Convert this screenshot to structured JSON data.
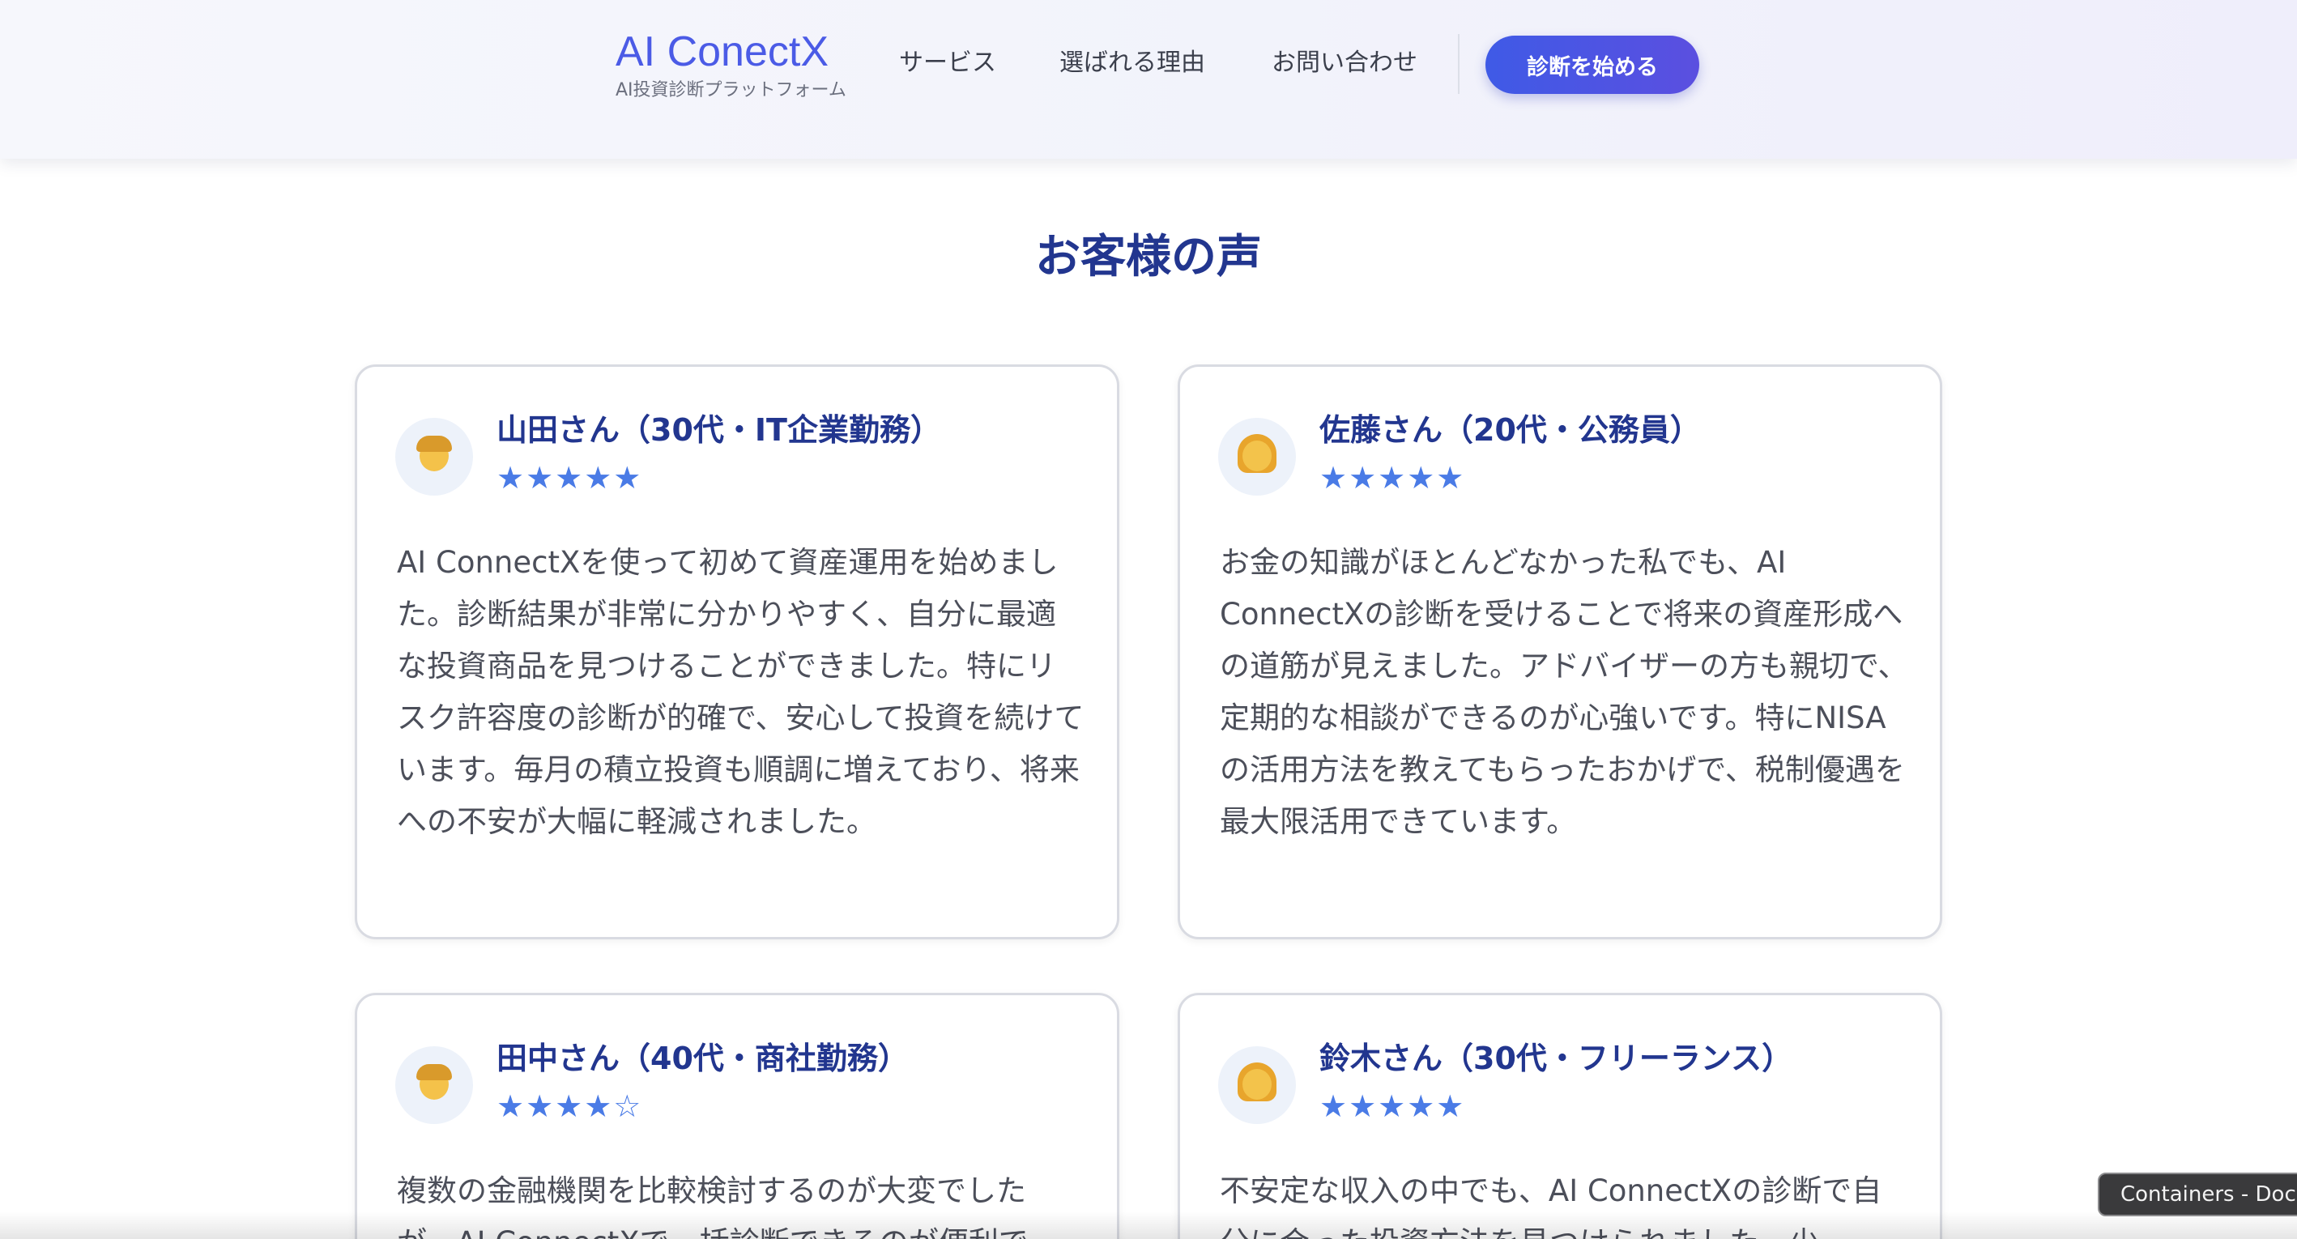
{
  "header": {
    "brand": "AI ConectX",
    "tagline": "AI投資診断プラットフォーム",
    "nav": [
      "サービス",
      "選ばれる理由",
      "お問い合わせ"
    ],
    "cta_label": "診断を始める"
  },
  "section": {
    "title": "お客様の声"
  },
  "testimonials": [
    {
      "name": "山田さん（30代・IT企業勤務）",
      "avatar_icon": "man-emoji-icon",
      "stars_display": "★★★★★",
      "rating": 5,
      "text": "AI ConnectXを使って初めて資産運用を始めました。診断結果が非常に分かりやすく、自分に最適な投資商品を見つけることができました。特にリスク許容度の診断が的確で、安心して投資を続けています。毎月の積立投資も順調に増えており、将来への不安が大幅に軽減されました。"
    },
    {
      "name": "佐藤さん（20代・公務員）",
      "avatar_icon": "woman-emoji-icon",
      "stars_display": "★★★★★",
      "rating": 5,
      "text": "お金の知識がほとんどなかった私でも、AI ConnectXの診断を受けることで将来の資産形成への道筋が見えました。アドバイザーの方も親切で、定期的な相談ができるのが心強いです。特にNISAの活用方法を教えてもらったおかげで、税制優遇を最大限活用できています。"
    },
    {
      "name": "田中さん（40代・商社勤務）",
      "avatar_icon": "man-emoji-icon",
      "stars_display": "★★★★☆",
      "rating": 4,
      "text": "複数の金融機関を比較検討するのが大変でしたが、AI ConnectXで一括診断できるのが便利で"
    },
    {
      "name": "鈴木さん（30代・フリーランス）",
      "avatar_icon": "woman-emoji-icon",
      "stars_display": "★★★★★",
      "rating": 5,
      "text": "不安定な収入の中でも、AI ConnectXの診断で自分に合った投資方法を見つけられました。少"
    }
  ],
  "tooltip": "Containers - Doc",
  "colors": {
    "brand": "#4b5be6",
    "heading": "#22368f",
    "star": "#4a7be6",
    "cta_start": "#3f5ae6",
    "cta_end": "#5b4fe0"
  }
}
